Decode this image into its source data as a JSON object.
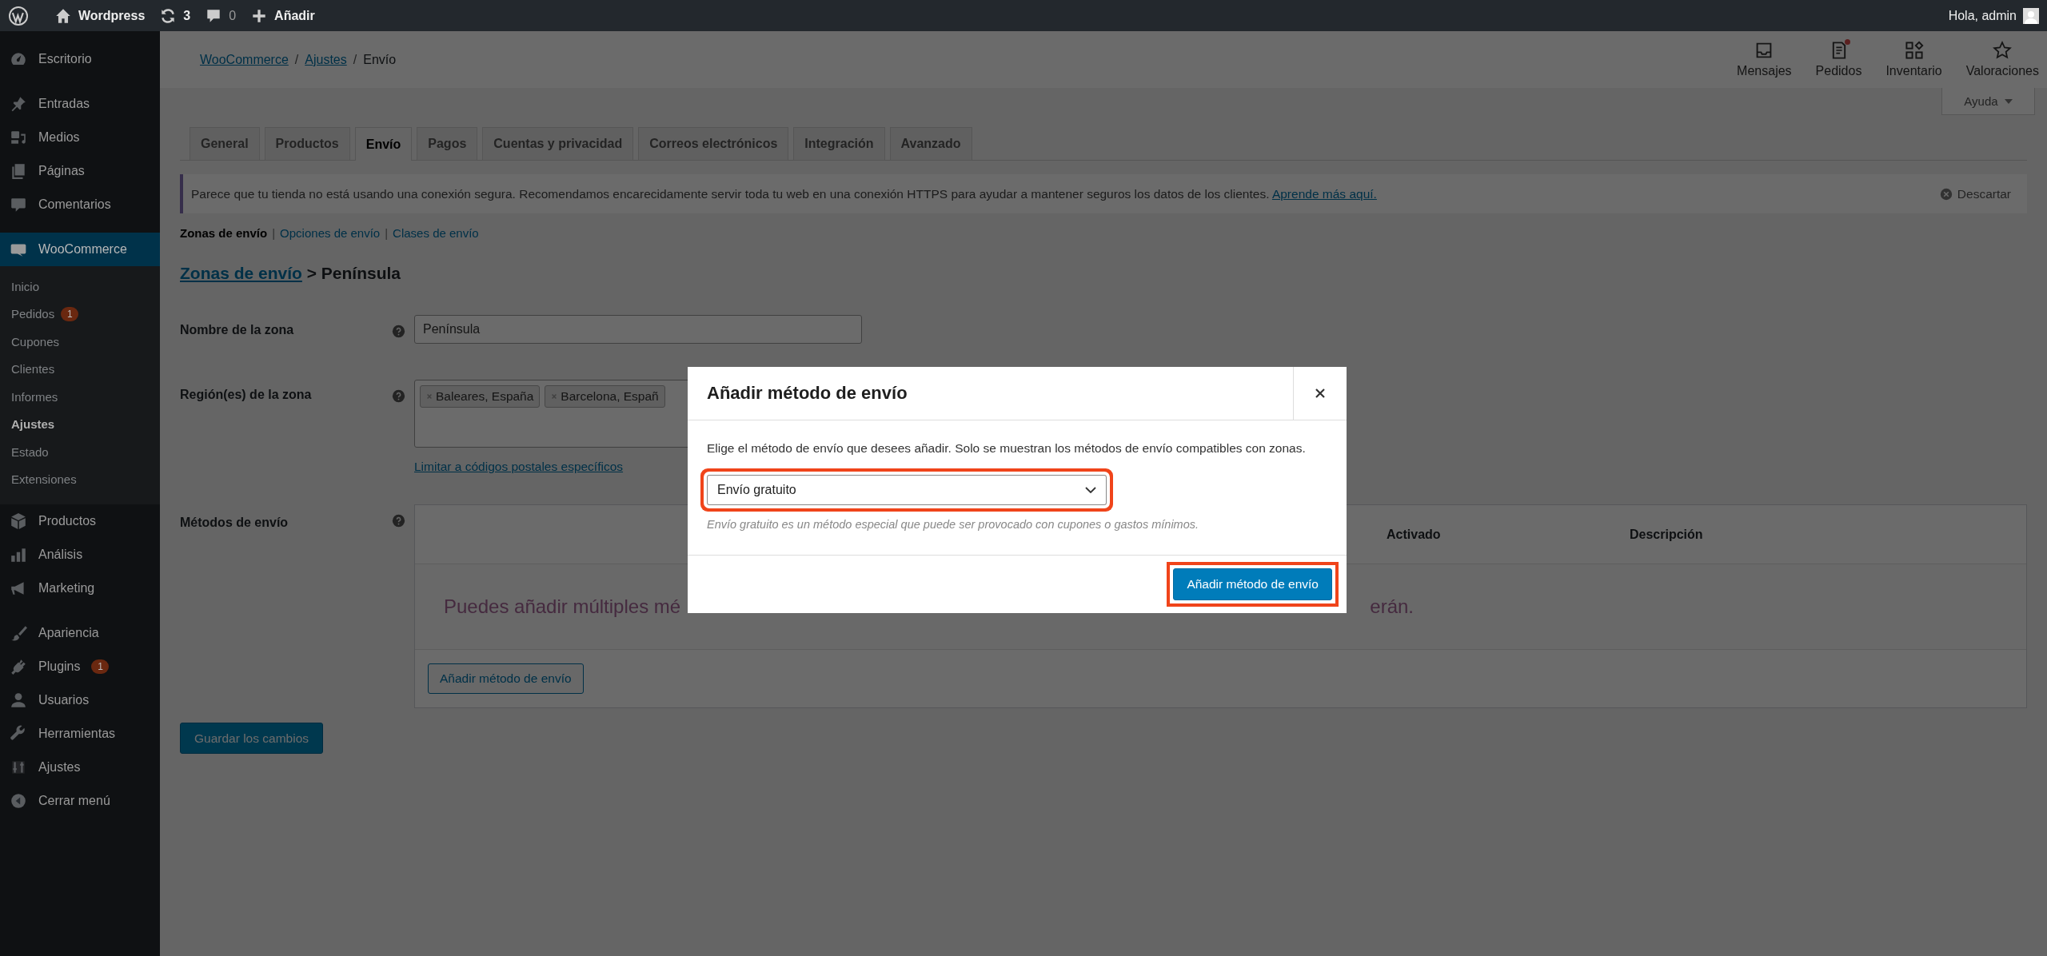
{
  "admin_bar": {
    "site": "Wordpress",
    "updates": "3",
    "comments": "0",
    "new": "Añadir",
    "greeting": "Hola, admin"
  },
  "sidebar": {
    "groups": [
      [
        {
          "label": "Escritorio",
          "kind": "dashboard",
          "selected": false
        }
      ],
      [
        {
          "label": "Entradas",
          "kind": "pin",
          "selected": false
        },
        {
          "label": "Medios",
          "kind": "media",
          "selected": false
        },
        {
          "label": "Páginas",
          "kind": "pages",
          "selected": false
        },
        {
          "label": "Comentarios",
          "kind": "comment",
          "selected": false
        }
      ],
      [
        {
          "label": "WooCommerce",
          "kind": "woo",
          "selected": true,
          "children": [
            {
              "label": "Inicio",
              "selected": false
            },
            {
              "label": "Pedidos",
              "selected": false,
              "badge": "1"
            },
            {
              "label": "Cupones",
              "selected": false
            },
            {
              "label": "Clientes",
              "selected": false
            },
            {
              "label": "Informes",
              "selected": false
            },
            {
              "label": "Ajustes",
              "selected": true
            },
            {
              "label": "Estado",
              "selected": false
            },
            {
              "label": "Extensiones",
              "selected": false
            }
          ]
        },
        {
          "label": "Productos",
          "kind": "box",
          "selected": false
        },
        {
          "label": "Análisis",
          "kind": "bars",
          "selected": false
        },
        {
          "label": "Marketing",
          "kind": "megaphone",
          "selected": false
        }
      ],
      [
        {
          "label": "Apariencia",
          "kind": "brush",
          "selected": false
        },
        {
          "label": "Plugins",
          "kind": "plug",
          "selected": false,
          "badge": "1"
        },
        {
          "label": "Usuarios",
          "kind": "user",
          "selected": false
        },
        {
          "label": "Herramientas",
          "kind": "wrench",
          "selected": false
        },
        {
          "label": "Ajustes",
          "kind": "sliders",
          "selected": false
        },
        {
          "label": "Cerrar menú",
          "kind": "collapse",
          "selected": false
        }
      ]
    ]
  },
  "header": {
    "breadcrumbs": [
      {
        "label": "WooCommerce",
        "link": true
      },
      {
        "label": "Ajustes",
        "link": true
      },
      {
        "label": "Envío",
        "link": false
      }
    ],
    "separator": "/",
    "actions": [
      {
        "label": "Mensajes",
        "kind": "inbox",
        "notification": false
      },
      {
        "label": "Pedidos",
        "kind": "document",
        "notification": true
      },
      {
        "label": "Inventario",
        "kind": "blocks",
        "notification": false
      },
      {
        "label": "Valoraciones",
        "kind": "star",
        "notification": false
      }
    ],
    "help_tab": "Ayuda"
  },
  "tabs": [
    {
      "label": "General",
      "selected": false
    },
    {
      "label": "Productos",
      "selected": false
    },
    {
      "label": "Envío",
      "selected": true
    },
    {
      "label": "Pagos",
      "selected": false
    },
    {
      "label": "Cuentas y privacidad",
      "selected": false
    },
    {
      "label": "Correos electrónicos",
      "selected": false
    },
    {
      "label": "Integración",
      "selected": false
    },
    {
      "label": "Avanzado",
      "selected": false
    }
  ],
  "notice": {
    "text": "Parece que tu tienda no está usando una conexión segura. Recomendamos encarecidamente servir toda tu web en una conexión HTTPS para ayudar a mantener seguros los datos de los clientes.",
    "link": "Aprende más aquí.",
    "dismiss": "Descartar"
  },
  "subnav": {
    "separator": "|",
    "items": [
      {
        "label": "Zonas de envío",
        "selected": true
      },
      {
        "label": "Opciones de envío",
        "selected": false
      },
      {
        "label": "Clases de envío",
        "selected": false
      }
    ]
  },
  "heading": {
    "link": "Zonas de envío",
    "rest": "> Península"
  },
  "form": {
    "zone_name": {
      "label": "Nombre de la zona",
      "value": "Península"
    },
    "regions": {
      "label": "Región(es) de la zona",
      "tags": [
        "Baleares, España",
        "Barcelona, Españ"
      ],
      "link": "Limitar a códigos postales específicos"
    },
    "methods": {
      "label": "Métodos de envío",
      "columns": [
        "Activado",
        "Descripción"
      ],
      "empty_start": "Puedes añadir múltiples mé",
      "empty_end": "erán.",
      "add_button": "Añadir método de envío"
    }
  },
  "save_button": "Guardar los cambios",
  "modal": {
    "title": "Añadir método de envío",
    "description": "Elige el método de envío que desees añadir. Solo se muestran los métodos de envío compatibles con zonas.",
    "select": {
      "value": "Envío gratuito",
      "highlighted": true
    },
    "hint": "Envío gratuito es un método especial que puede ser provocado con cupones o gastos mínimos.",
    "submit": {
      "label": "Añadir método de envío",
      "highlighted": true
    }
  }
}
